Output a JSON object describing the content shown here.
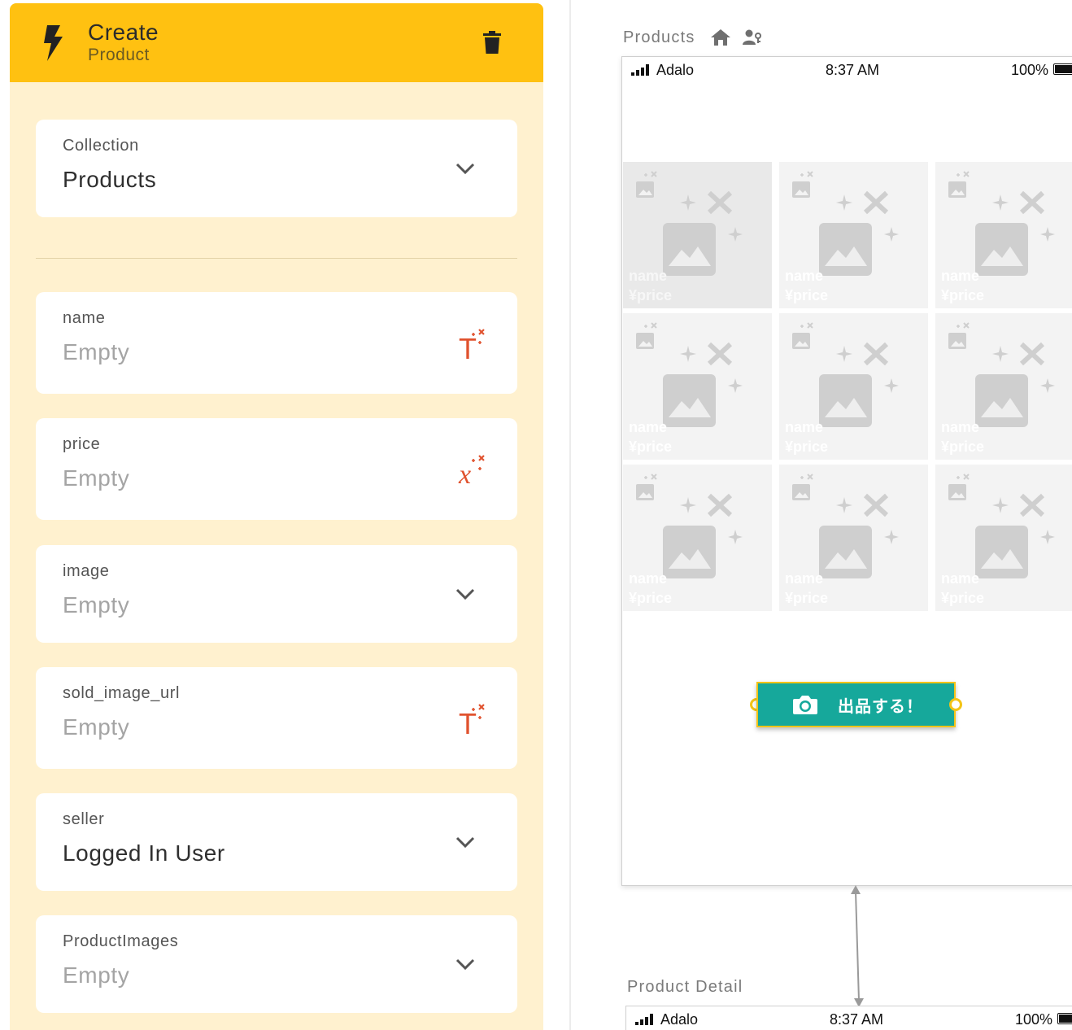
{
  "action_panel": {
    "title": "Create",
    "subtitle": "Product",
    "fields": [
      {
        "label": "Collection",
        "value": "Products",
        "control": "dropdown",
        "empty": false
      },
      {
        "label": "name",
        "value": "Empty",
        "control": "magic-text",
        "empty": true
      },
      {
        "label": "price",
        "value": "Empty",
        "control": "magic-number",
        "empty": true
      },
      {
        "label": "image",
        "value": "Empty",
        "control": "dropdown",
        "empty": true
      },
      {
        "label": "sold_image_url",
        "value": "Empty",
        "control": "magic-text",
        "empty": true
      },
      {
        "label": "seller",
        "value": "Logged In User",
        "control": "dropdown",
        "empty": false
      },
      {
        "label": "ProductImages",
        "value": "Empty",
        "control": "dropdown",
        "empty": true
      }
    ],
    "colors": {
      "header": "#ffc111",
      "background": "#fff1cf",
      "magic_accent": "#e0522e"
    }
  },
  "canvas": {
    "main_screen": {
      "name": "Products",
      "icons": [
        "home-icon",
        "user-permissions-icon"
      ],
      "status_bar": {
        "carrier": "Adalo",
        "time": "8:37 AM",
        "battery": "100%"
      },
      "grid": {
        "rows": 3,
        "columns": 3,
        "items": [
          {
            "name": "name",
            "price": "¥price"
          },
          {
            "name": "name",
            "price": "¥price"
          },
          {
            "name": "name",
            "price": "¥price"
          },
          {
            "name": "name",
            "price": "¥price"
          },
          {
            "name": "name",
            "price": "¥price"
          },
          {
            "name": "name",
            "price": "¥price"
          },
          {
            "name": "name",
            "price": "¥price"
          },
          {
            "name": "name",
            "price": "¥price"
          },
          {
            "name": "name",
            "price": "¥price"
          }
        ]
      },
      "sell_button": {
        "label": "出品する！",
        "icon": "camera-icon",
        "color": "#16a89b",
        "selection_color": "#f3c417"
      }
    },
    "detail_screen": {
      "name": "Product Detail",
      "status_bar": {
        "carrier": "Adalo",
        "time": "8:37 AM",
        "battery": "100%"
      }
    }
  }
}
